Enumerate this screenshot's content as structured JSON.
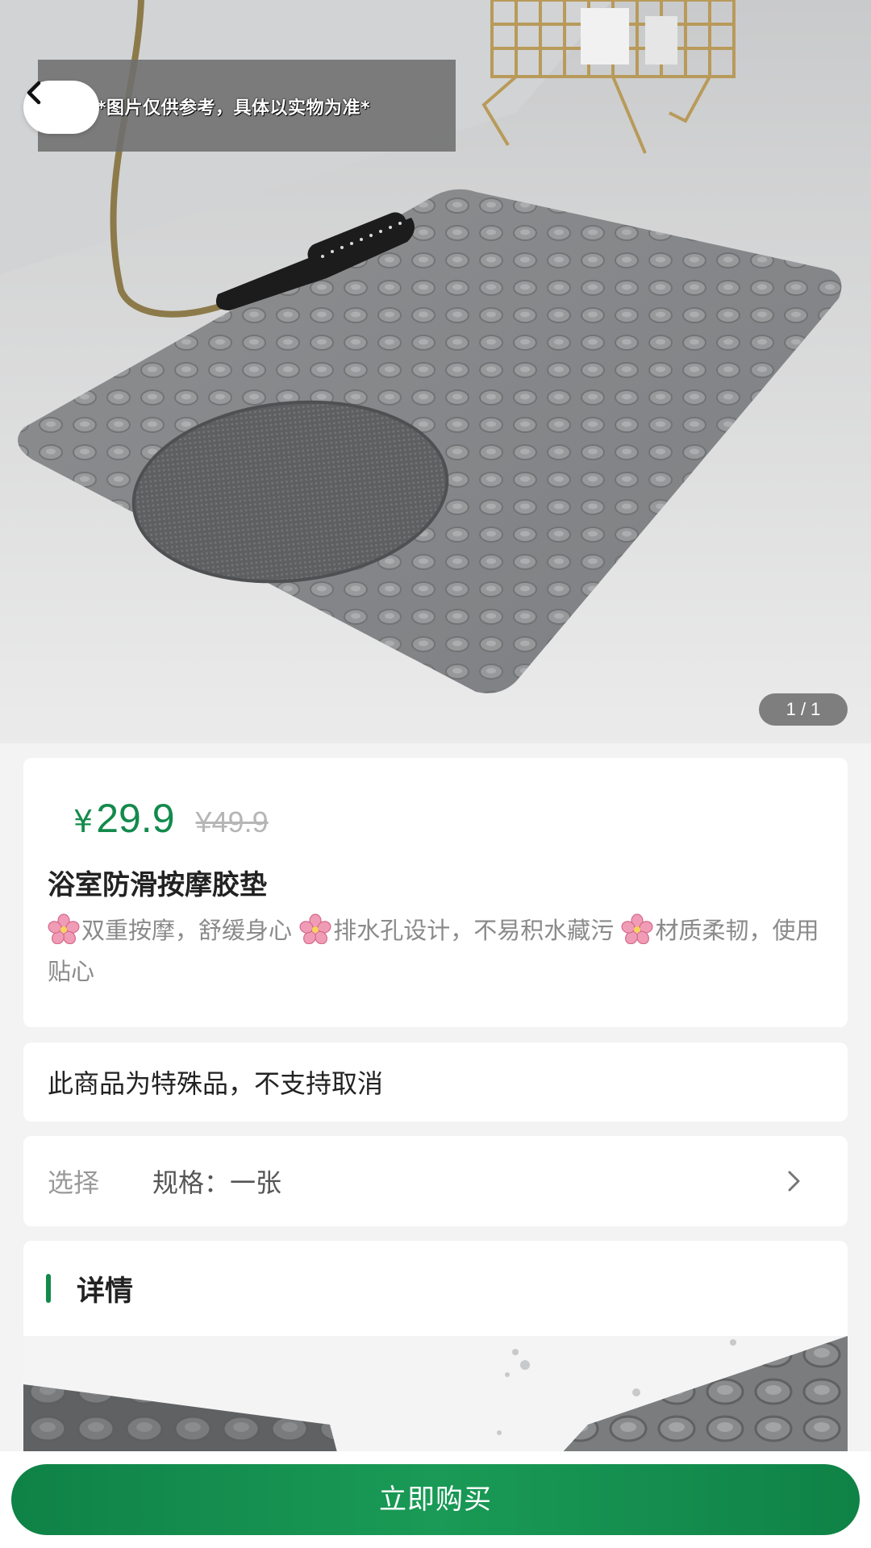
{
  "hero": {
    "notice": "*图片仅供参考，具体以实物为准*",
    "counter": "1 / 1"
  },
  "product": {
    "price_symbol": "¥",
    "price": "29.9",
    "original_price": "¥49.9",
    "title": "浴室防滑按摩胶垫",
    "features": [
      "双重按摩，舒缓身心 ",
      "排水孔设计，不易积水藏污 ",
      "材质柔韧，使用贴心"
    ]
  },
  "notice_card": {
    "text": "此商品为特殊品，不支持取消"
  },
  "spec": {
    "label": "选择",
    "value": "规格：一张"
  },
  "detail": {
    "title": "详情"
  },
  "bottom": {
    "buy_label": "立即购买"
  },
  "colors": {
    "accent": "#138a4c",
    "price": "#138a4c",
    "muted": "#8a8a8a"
  },
  "icons": [
    "back-arrow-icon",
    "cherry-blossom-icon",
    "chevron-right-icon"
  ]
}
